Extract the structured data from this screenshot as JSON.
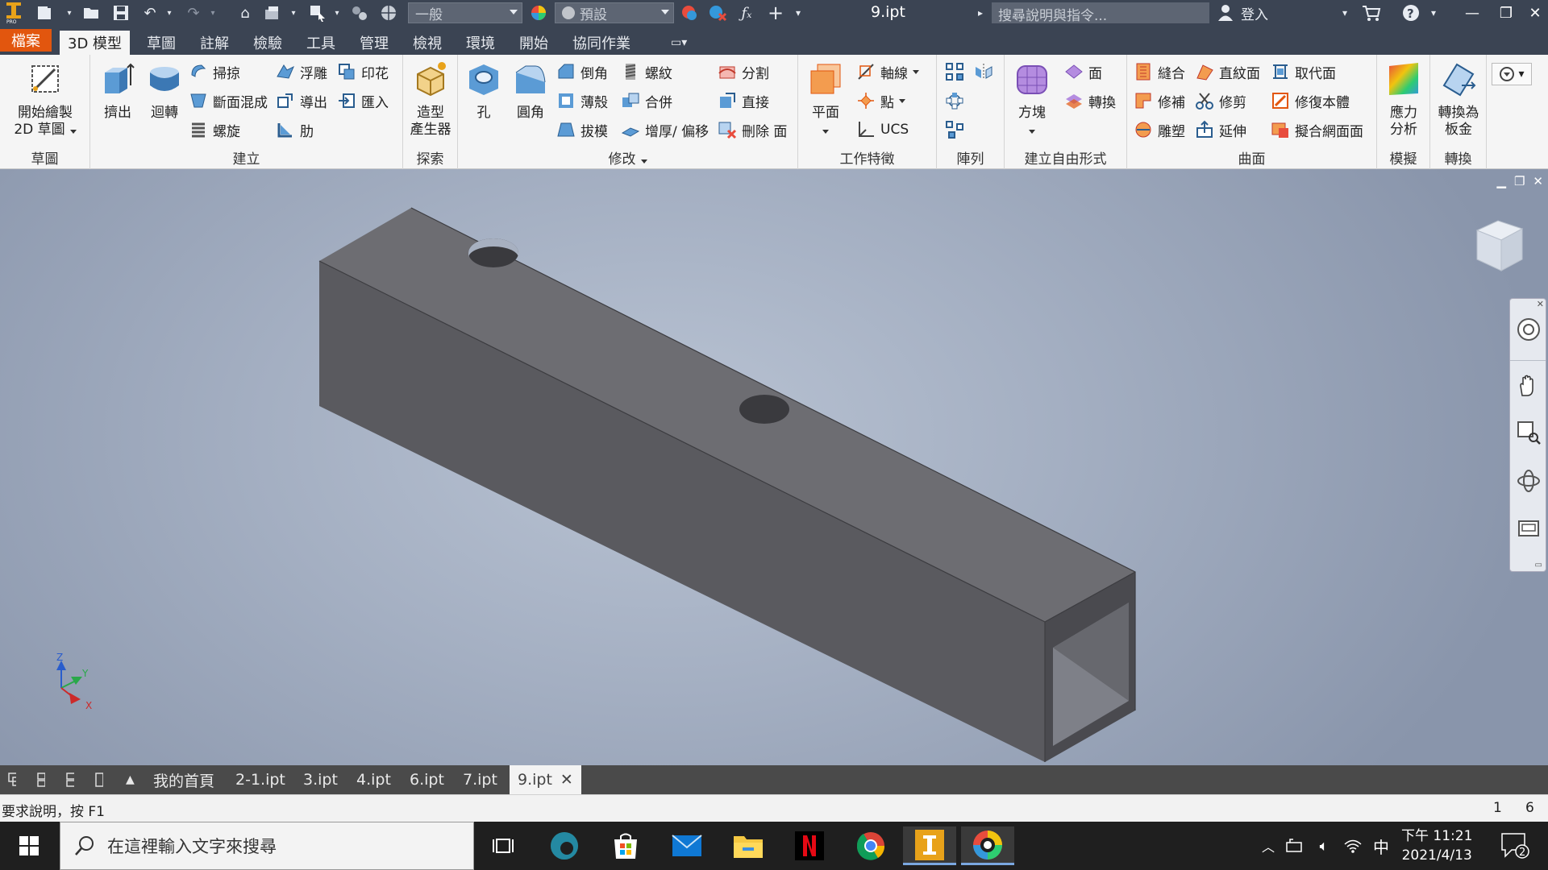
{
  "titlebar": {
    "style_dropdown": "一般",
    "appearance_dropdown": "預設",
    "doc_title": "9.ipt",
    "help_search_placeholder": "搜尋說明與指令...",
    "sign_in": "登入"
  },
  "tabs": {
    "file": "檔案",
    "items": [
      "3D 模型",
      "草圖",
      "註解",
      "檢驗",
      "工具",
      "管理",
      "檢視",
      "環境",
      "開始",
      "協同作業"
    ]
  },
  "ribbon": {
    "sketch": {
      "label": "草圖",
      "start_sketch_l1": "開始繪製",
      "start_sketch_l2": "2D 草圖"
    },
    "create": {
      "label": "建立",
      "extrude": "擠出",
      "revolve": "迴轉",
      "sweep": "掃掠",
      "loft": "斷面混成",
      "coil": "螺旋",
      "emboss": "浮雕",
      "derive": "導出",
      "rib": "肋",
      "decal": "印花",
      "import": "匯入"
    },
    "explore": {
      "label": "探索",
      "shape_gen_l1": "造型",
      "shape_gen_l2": "產生器"
    },
    "modify": {
      "label": "修改",
      "hole": "孔",
      "fillet": "圓角",
      "chamfer": "倒角",
      "shell": "薄殼",
      "draft": "拔模",
      "thread": "螺紋",
      "combine": "合併",
      "thicken": "增厚/ 偏移",
      "split": "分割",
      "direct": "直接",
      "delete_face": "刪除 面"
    },
    "work": {
      "label": "工作特徵",
      "plane": "平面",
      "axis": "軸線",
      "point": "點",
      "ucs": "UCS"
    },
    "pattern": {
      "label": "陣列"
    },
    "freeform": {
      "label": "建立自由形式",
      "box": "方塊",
      "face": "面",
      "convert": "轉換"
    },
    "surface": {
      "label": "曲面",
      "stitch": "縫合",
      "patch": "修補",
      "sculpt": "雕塑",
      "ruled": "直紋面",
      "trim": "修剪",
      "extend": "延伸",
      "replace_face": "取代面",
      "repair": "修復本體",
      "fit_mesh": "擬合網面面"
    },
    "simulation": {
      "label": "模擬",
      "stress_l1": "應力",
      "stress_l2": "分析"
    },
    "convert": {
      "label": "轉換",
      "sheet_l1": "轉換為",
      "sheet_l2": "板金"
    }
  },
  "viewport": {
    "axis_x": "X",
    "axis_y": "Y",
    "axis_z": "Z"
  },
  "doctabs": [
    "我的首頁",
    "2-1.ipt",
    "3.ipt",
    "4.ipt",
    "6.ipt",
    "7.ipt",
    "9.ipt"
  ],
  "status": {
    "text": "要求說明，按 F1",
    "num1": "1",
    "num2": "6"
  },
  "taskbar": {
    "search_placeholder": "在這裡輸入文字來搜尋",
    "ime": "中",
    "time": "下午 11:21",
    "date": "2021/4/13",
    "notifications": "2"
  },
  "colors": {
    "titlebar": "#3b4453",
    "file_tab": "#e2560e",
    "part": "#5e5e63",
    "viewport": "#a4afc2"
  }
}
